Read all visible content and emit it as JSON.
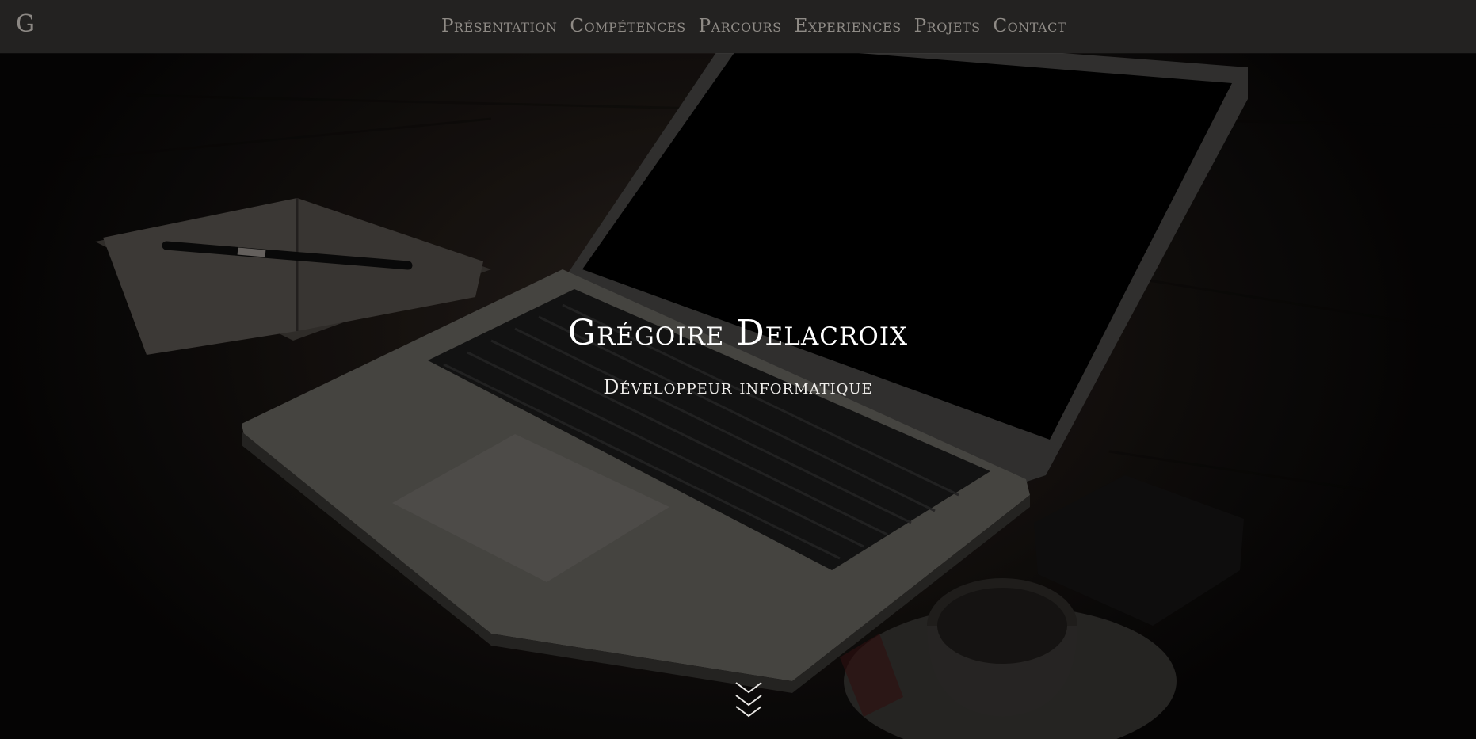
{
  "brand": {
    "label": "G"
  },
  "nav": {
    "items": [
      {
        "label": "Présentation"
      },
      {
        "label": "Compétences"
      },
      {
        "label": "Parcours"
      },
      {
        "label": "Experiences"
      },
      {
        "label": "Projets"
      },
      {
        "label": "Contact"
      }
    ]
  },
  "hero": {
    "title": "Grégoire Delacroix",
    "subtitle": "Développeur informatique"
  },
  "icons": {
    "scroll": "double-chevron-down-icon"
  },
  "colors": {
    "navbar_bg": "#232221",
    "nav_text": "#8f8b86",
    "hero_text": "#ffffff"
  }
}
